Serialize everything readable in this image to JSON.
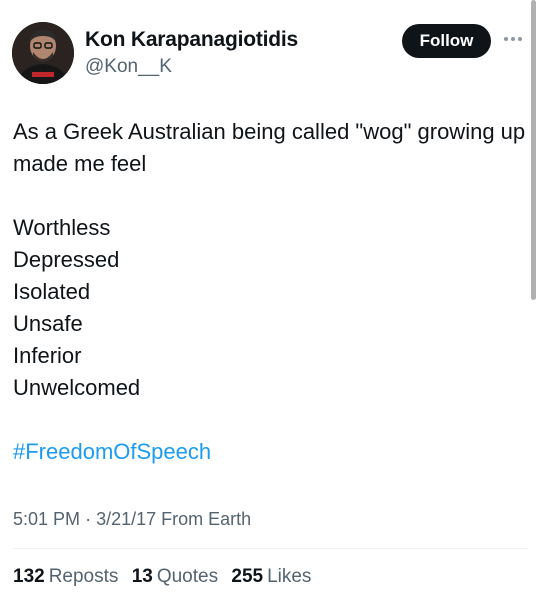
{
  "author": {
    "display_name": "Kon Karapanagiotidis",
    "handle": "@Kon__K"
  },
  "actions": {
    "follow_label": "Follow",
    "more_icon": "more-horizontal-icon"
  },
  "tweet": {
    "intro": "As a Greek Australian being called \"wog\" growing up made me feel",
    "words": [
      "Worthless",
      "Depressed",
      "Isolated",
      "Unsafe",
      "Inferior",
      "Unwelcomed"
    ],
    "hashtag": "#FreedomOfSpeech"
  },
  "meta": {
    "time": "5:01 PM",
    "separator": "·",
    "date": "3/21/17",
    "source": "From Earth"
  },
  "stats": {
    "reposts_count": "132",
    "reposts_label": "Reposts",
    "quotes_count": "13",
    "quotes_label": "Quotes",
    "likes_count": "255",
    "likes_label": "Likes"
  },
  "colors": {
    "text_primary": "#0f1419",
    "text_secondary": "#536471",
    "link": "#1d9bf0",
    "follow_bg": "#0f1419"
  }
}
